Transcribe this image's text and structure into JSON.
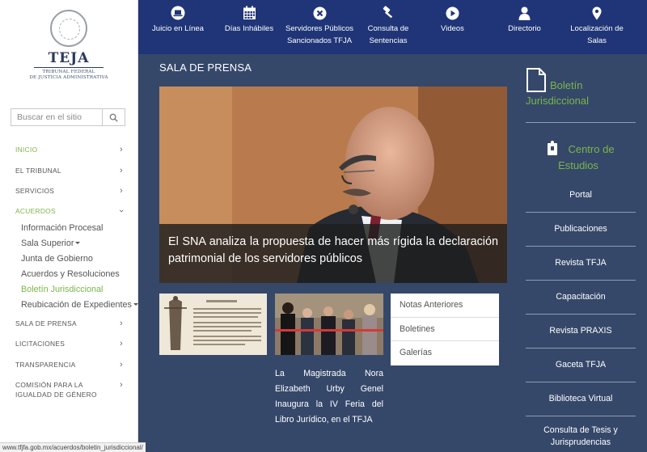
{
  "logo": {
    "name": "TEJA",
    "subtitle_line1": "TRIBUNAL FEDERAL",
    "subtitle_line2": "DE JUSTICIA ADMINISTRATIVA"
  },
  "search": {
    "placeholder": "Buscar en el sitio"
  },
  "sidebar": {
    "items": [
      {
        "label": "INICIO"
      },
      {
        "label": "EL TRIBUNAL"
      },
      {
        "label": "SERVICIOS"
      },
      {
        "label": "ACUERDOS"
      },
      {
        "label": "SALA DE PRENSA"
      },
      {
        "label": "LICITACIONES"
      },
      {
        "label": "TRANSPARENCIA"
      },
      {
        "label": "COMISIÓN PARA LA IGUALDAD DE GÉNERO"
      }
    ],
    "subitems": [
      {
        "label": "Información Procesal"
      },
      {
        "label": "Sala Superior"
      },
      {
        "label": "Junta de Gobierno"
      },
      {
        "label": "Acuerdos y Resoluciones"
      },
      {
        "label": "Boletín Jurisdiccional"
      },
      {
        "label": "Reubicación de Expedientes"
      }
    ]
  },
  "status_url": "www.tfjfa.gob.mx/acuerdos/boletin_jurisdiccional/",
  "topnav": [
    {
      "label": "Juicio en Línea",
      "icon": "laptop-icon"
    },
    {
      "label": "Días Inhábiles",
      "icon": "calendar-icon"
    },
    {
      "label": "Servidores Públicos Sancionados TFJA",
      "icon": "close-circle-icon"
    },
    {
      "label": "Consulta de Sentencias",
      "icon": "gavel-icon"
    },
    {
      "label": "Videos",
      "icon": "play-icon"
    },
    {
      "label": "Directorio",
      "icon": "user-icon"
    },
    {
      "label": "Localización de Salas",
      "icon": "map-marker-icon"
    }
  ],
  "main": {
    "section_title": "SALA DE PRENSA",
    "hero_caption": "El SNA analiza la propuesta de hacer más rígida la declaración patrimonial de los servidores públicos",
    "news_caption": "La Magistrada Nora Elizabeth Urby Genel Inaugura la IV Feria del Libro Jurídico, en el TFJA",
    "links": [
      {
        "label": "Notas Anteriores"
      },
      {
        "label": "Boletines"
      },
      {
        "label": "Galerías"
      }
    ]
  },
  "right": {
    "boletin_line1": "Boletín",
    "boletin_line2": "Jurisdiccional",
    "centro_line1": "Centro de",
    "centro_line2": "Estudios",
    "links": [
      {
        "label": "Portal"
      },
      {
        "label": "Publicaciones"
      },
      {
        "label": "Revista TFJA"
      },
      {
        "label": "Capacitación"
      },
      {
        "label": "Revista PRAXIS"
      },
      {
        "label": "Gaceta TFJA"
      },
      {
        "label": "Biblioteca Virtual"
      },
      {
        "label": "Consulta de Tesis y Jurisprudencias"
      }
    ]
  },
  "colors": {
    "topbar": "#1f3577",
    "background": "#35486a",
    "accent": "#7ab648"
  }
}
